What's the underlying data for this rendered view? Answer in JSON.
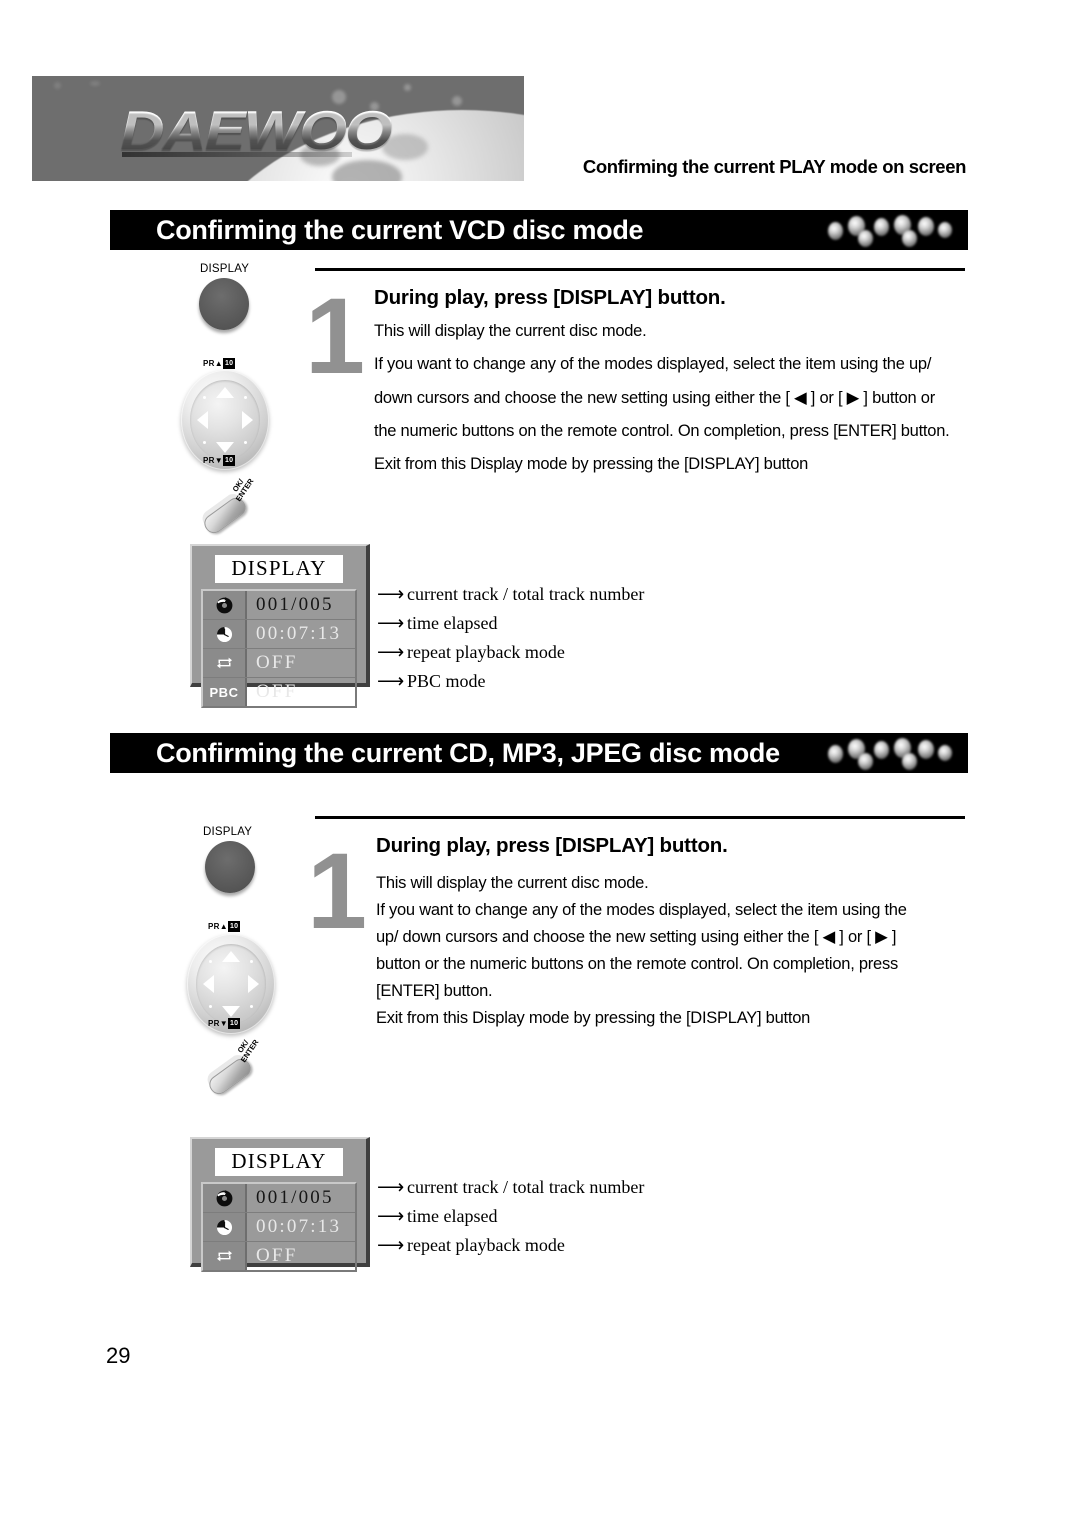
{
  "document": {
    "page_number": "29",
    "running_head": "Confirming the current PLAY mode on screen",
    "brand": "DAEWOO"
  },
  "sections": [
    {
      "banner_title": "Confirming the current VCD disc mode",
      "step": {
        "number": "1",
        "heading": "During play, press [DISPLAY] button.",
        "lines": [
          "This will display the current disc mode.",
          "If you want to change any of the modes displayed, select the item using the up/",
          "down cursors and choose the new setting using either the [ ◀ ] or [ ▶ ] button or",
          "the numeric buttons on the remote control. On completion, press [ENTER] button.",
          "Exit from this Display mode by pressing the [DISPLAY] button"
        ]
      },
      "remote": {
        "display_label": "DISPLAY",
        "pr_up_label": "PR",
        "pr_down_label": "PR",
        "enter_label_line1": "OK/",
        "enter_label_line2": "ENTER"
      },
      "osd": {
        "title": "DISPLAY",
        "rows": [
          {
            "icon": "disc-track-icon",
            "value": "001/005",
            "callout": "current track  / total track number"
          },
          {
            "icon": "clock-icon",
            "value": "00:07:13",
            "callout": "time elapsed"
          },
          {
            "icon": "repeat-icon",
            "value": "OFF",
            "callout": "repeat playback mode"
          },
          {
            "icon": "pbc-icon",
            "icon_text": "PBC",
            "value": "OFF",
            "callout": "PBC mode"
          }
        ]
      }
    },
    {
      "banner_title": "Confirming the current CD, MP3, JPEG disc mode",
      "step": {
        "number": "1",
        "heading": "During play, press [DISPLAY] button.",
        "lines": [
          "This will display the current disc mode.",
          "If you want to change any of the modes displayed, select the item using the",
          "up/ down cursors and choose the new setting using either the [ ◀ ] or [ ▶ ]",
          "button or the numeric buttons on the remote control. On completion, press",
          "[ENTER] button.",
          "Exit from this Display mode by pressing the [DISPLAY] button"
        ]
      },
      "remote": {
        "display_label": "DISPLAY",
        "pr_up_label": "PR",
        "pr_down_label": "PR",
        "enter_label_line1": "OK/",
        "enter_label_line2": "ENTER"
      },
      "osd": {
        "title": "DISPLAY",
        "rows": [
          {
            "icon": "disc-track-icon",
            "value": "001/005",
            "callout": "current track  / total track number"
          },
          {
            "icon": "clock-icon",
            "value": "00:07:13",
            "callout": "time elapsed"
          },
          {
            "icon": "repeat-icon",
            "value": "OFF",
            "callout": "repeat playback mode"
          }
        ]
      }
    }
  ],
  "colors": {
    "banner_background": "#000000",
    "banner_text": "#ffffff",
    "osd_background": "#9a9a9a",
    "step_number": "#919191",
    "body_text": "#000000"
  }
}
